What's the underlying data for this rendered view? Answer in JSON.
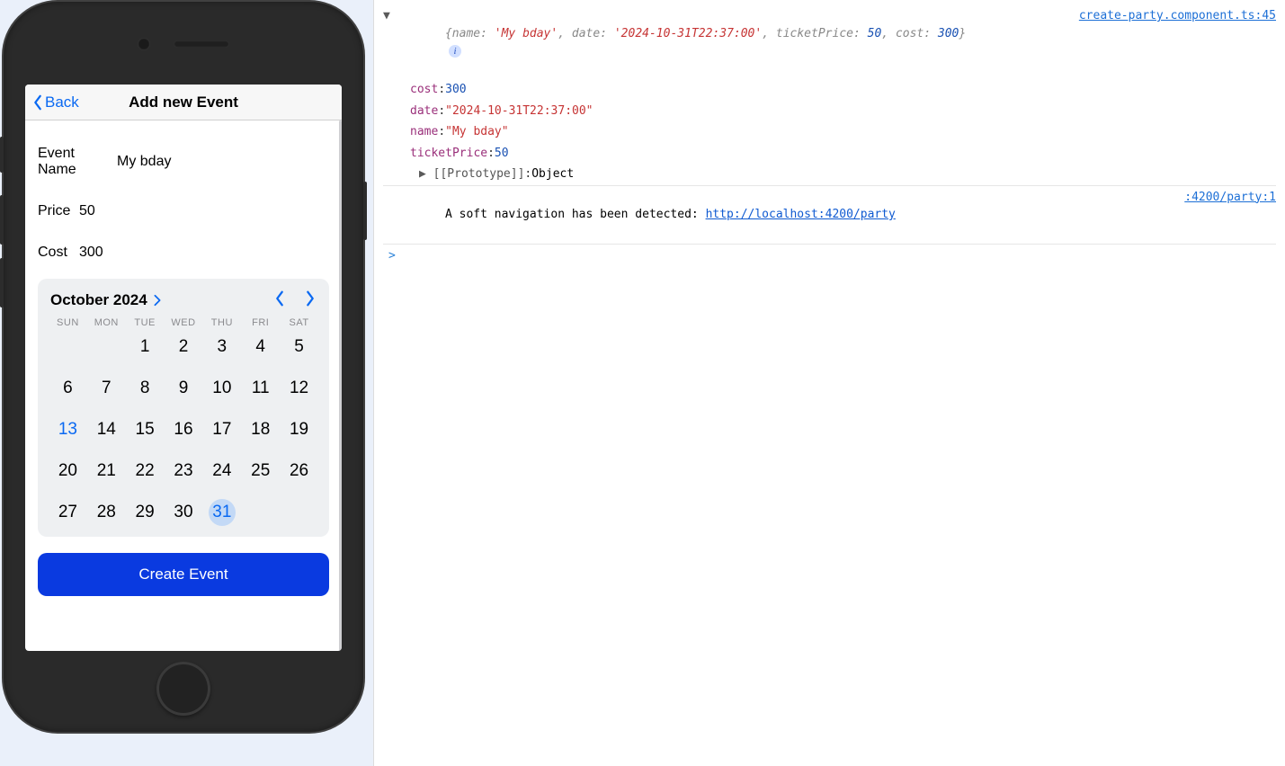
{
  "phone": {
    "nav": {
      "back_label": "Back",
      "title": "Add new Event"
    },
    "form": {
      "event_name_label": "Event Name",
      "event_name_value": "My bday",
      "price_label": "Price",
      "price_value": "50",
      "cost_label": "Cost",
      "cost_value": "300"
    },
    "calendar": {
      "month_label": "October 2024",
      "weekdays": [
        "SUN",
        "MON",
        "TUE",
        "WED",
        "THU",
        "FRI",
        "SAT"
      ],
      "leading_blanks": 2,
      "days_in_month": 31,
      "today": 13,
      "selected": 31
    },
    "create_button_label": "Create Event"
  },
  "console": {
    "source_link": "create-party.component.ts:45",
    "summary": {
      "name_key": "name",
      "name_val": "'My bday'",
      "date_key": "date",
      "date_val": "'2024-10-31T22:37:00'",
      "ticketPrice_key": "ticketPrice",
      "ticketPrice_val": "50",
      "cost_key": "cost",
      "cost_val": "300"
    },
    "expanded": [
      {
        "key": "cost",
        "type": "num",
        "val": "300"
      },
      {
        "key": "date",
        "type": "str",
        "val": "\"2024-10-31T22:37:00\""
      },
      {
        "key": "name",
        "type": "str",
        "val": "\"My bday\""
      },
      {
        "key": "ticketPrice",
        "type": "num",
        "val": "50"
      }
    ],
    "prototype_label": "[[Prototype]]",
    "prototype_value": "Object",
    "soft_nav_prefix": "A soft navigation has been detected: ",
    "soft_nav_url": "http://localhost:4200/party",
    "soft_nav_src": ":4200/party:1",
    "prompt_symbol": ">"
  }
}
